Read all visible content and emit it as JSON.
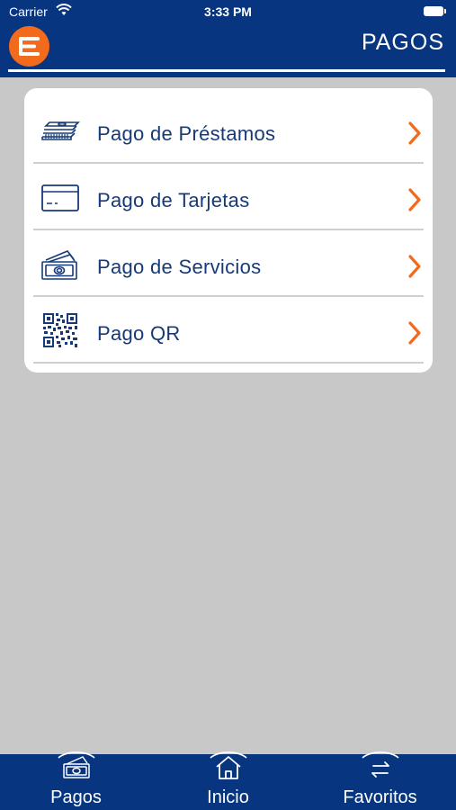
{
  "status_bar": {
    "carrier": "Carrier",
    "time": "3:33 PM"
  },
  "header": {
    "title": "PAGOS",
    "menu_icon": "menu-icon"
  },
  "colors": {
    "primary": "#07357f",
    "accent": "#f26a1b",
    "text": "#163a78",
    "background": "#c8c8c8"
  },
  "menu": {
    "items": [
      {
        "label": "Pago de Préstamos",
        "icon": "cash-stack-icon"
      },
      {
        "label": "Pago de Tarjetas",
        "icon": "credit-card-icon"
      },
      {
        "label": "Pago de Servicios",
        "icon": "banknotes-icon"
      },
      {
        "label": "Pago QR",
        "icon": "qr-code-icon"
      }
    ]
  },
  "tabbar": {
    "tabs": [
      {
        "label": "Pagos",
        "icon": "banknotes-icon"
      },
      {
        "label": "Inicio",
        "icon": "home-icon"
      },
      {
        "label": "Favoritos",
        "icon": "swap-arrows-icon"
      }
    ]
  }
}
